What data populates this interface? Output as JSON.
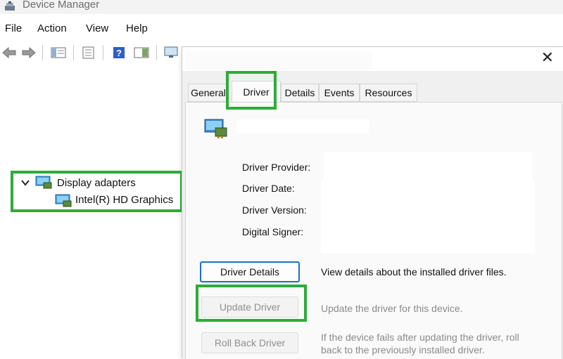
{
  "window": {
    "title": "Device Manager"
  },
  "menu": [
    "File",
    "Action",
    "View",
    "Help"
  ],
  "tree": {
    "category": "Display adapters",
    "device": "Intel(R) HD Graphics"
  },
  "dialog": {
    "close_glyph": "✕",
    "tabs": [
      "General",
      "Driver",
      "Details",
      "Events",
      "Resources"
    ],
    "active_tab": "Driver",
    "fields": {
      "provider": "Driver Provider:",
      "date": "Driver Date:",
      "version": "Driver Version:",
      "signer": "Digital Signer:"
    },
    "buttons": {
      "details": {
        "label": "Driver Details",
        "description": "View details about the installed driver files."
      },
      "update": {
        "label": "Update Driver",
        "description": "Update the driver for this device."
      },
      "rollback": {
        "label": "Roll Back Driver",
        "description_line1": "If the device fails after updating the driver, roll",
        "description_line2": "back to the previously installed driver."
      }
    }
  },
  "highlight_color": "#2fab3a",
  "accent_color": "#1d70c4"
}
